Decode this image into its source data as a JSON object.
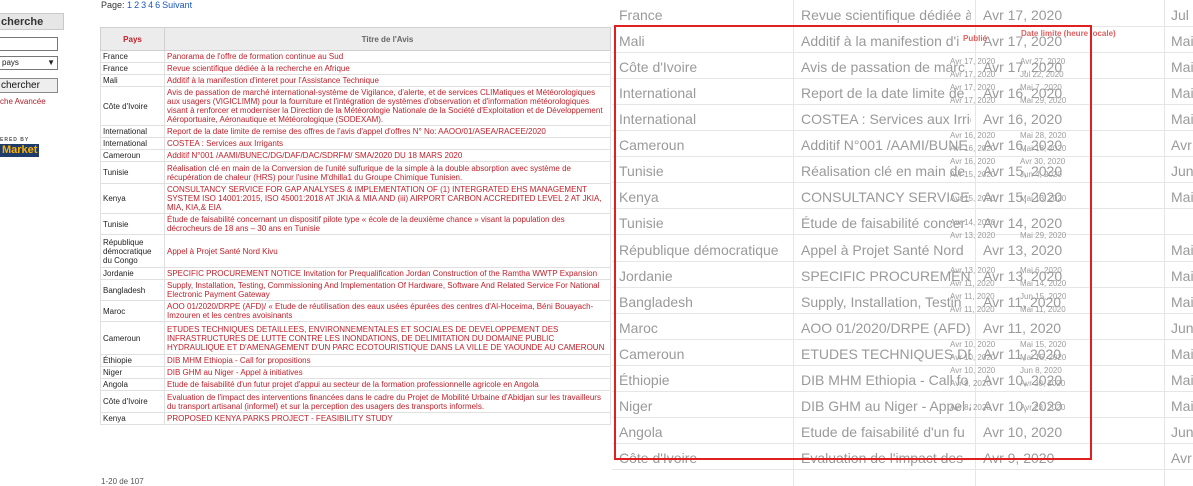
{
  "sidebar": {
    "title": "cherche",
    "select_value": "pays",
    "button_label": "chercher",
    "advanced_link": "che Avancée",
    "powered_by": "ERED BY",
    "logo_text": "Market"
  },
  "pager": {
    "prefix": "Page:",
    "pages": [
      "1",
      "2",
      "3",
      "4",
      "6"
    ],
    "next": "Suivant"
  },
  "results_count": "1-20 de 107",
  "table": {
    "headers": {
      "country": "Pays",
      "title": "Titre de l'Avis",
      "published": "Publié",
      "deadline": "Date limite (heure locale)"
    },
    "rows": [
      {
        "country": "France",
        "title": "Panorama de l'offre de formation continue au Sud",
        "published": "Avr 17, 2020",
        "deadline": "Avr 27, 2020"
      },
      {
        "country": "France",
        "title": "Revue scientifique dédiée à la recherche en Afrique",
        "published": "Avr 17, 2020",
        "deadline": "Jul 22, 2020"
      },
      {
        "country": "Mali",
        "title": "Additif à la manifestion d'interet pour l'Assistance Technique",
        "published": "Avr 17, 2020",
        "deadline": "Mai 7, 2020"
      },
      {
        "country": "Côte d'Ivoire",
        "title": "Avis de passation de marché international-système de Vigilance, d'alerte, et de services CLIMatiques et Météorologiques aux usagers (VIGICLIMM) pour la fourniture et l'intégration de systèmes d'observation et d'information météorologiques visant à renforcer et moderniser la Direction de la Météorologie Nationale de la Société d'Exploitation et de Développement Aéroportuaire, Aéronautique et Météorologique (SODEXAM).",
        "published": "Avr 17, 2020",
        "deadline": "Mai 29, 2020"
      },
      {
        "country": "International",
        "title": "Report de la date limite de remise des offres de l'avis d'appel d'offres N° No: AAOO/01/ASEA/RACEE/2020",
        "published": "Avr 16, 2020",
        "deadline": "Mai 28, 2020"
      },
      {
        "country": "International",
        "title": "COSTEA : Services aux Irrigants",
        "published": "Avr 16, 2020",
        "deadline": "Mai 18, 2020"
      },
      {
        "country": "Cameroun",
        "title": "Additif N°001 /AAMI/BUNEC/DG/DAF/DAC/SDRFM/ SMA/2020 DU 18 MARS 2020",
        "published": "Avr 16, 2020",
        "deadline": "Avr 30, 2020"
      },
      {
        "country": "Tunisie",
        "title": "Réalisation clé en main de la Conversion de l'unité sulfurique de la simple à la double absorption avec système de récupération de chaleur (HRS) pour l'usine M'dhilla1 du Groupe Chimique Tunisien.",
        "published": "Avr 15, 2020",
        "deadline": "Jun 4, 2020"
      },
      {
        "country": "Kenya",
        "title": "CONSULTANCY SERVICE FOR GAP ANALYSES & IMPLEMENTATION OF (1) INTERGRATED EHS MANAGEMENT SYSTEM ISO 14001:2015, ISO 45001:2018 AT JKIA & MIA AND (iii) AIRPORT CARBON ACCREDITED LEVEL 2 AT JKIA, MIA, KIA,& EIA",
        "published": "Avr 15, 2020",
        "deadline": "Mai 13, 2020"
      },
      {
        "country": "Tunisie",
        "title": "Étude de faisabilité concernant un dispositif pilote type « école de la deuxième chance » visant la population des décrocheurs de 18 ans – 30 ans en Tunisie",
        "published": "Avr 14, 2020",
        "deadline": ""
      },
      {
        "country": "République démocratique du Congo",
        "title": "Appel à Projet Santé Nord Kivu",
        "published": "Avr 13, 2020",
        "deadline": "Mai 29, 2020"
      },
      {
        "country": "Jordanie",
        "title": "SPECIFIC PROCUREMENT NOTICE Invitation for Prequalification Jordan Construction of the Ramtha WWTP Expansion",
        "published": "Avr 13, 2020",
        "deadline": "Mai 6, 2020"
      },
      {
        "country": "Bangladesh",
        "title": "Supply, Installation, Testing, Commissioning And Implementation Of Hardware, Software And Related Service For National Electronic Payment Gateway",
        "published": "Avr 11, 2020",
        "deadline": "Mai 14, 2020"
      },
      {
        "country": "Maroc",
        "title": "AOO 01/2020/DRPE (AFD)/ « Etude de réutilisation des eaux usées épurées des centres d'Al-Hoceima, Béni Bouayach-Imzouren et les centres avoisinants",
        "published": "Avr 11, 2020",
        "deadline": "Jun 15, 2020"
      },
      {
        "country": "Cameroun",
        "title": "ETUDES TECHNIQUES DETAILLEES, ENVIRONNEMENTALES ET SOCIALES DE DEVELOPPEMENT DES INFRASTRUCTURES DE LUTTE CONTRE LES INONDATIONS, DE DELIMITATION DU DOMAINE PUBLIC HYDRAULIQUE ET D'AMENAGEMENT D'UN PARC ECOTOURISTIQUE DANS LA VILLE DE YAOUNDE AU CAMEROUN",
        "published": "Avr 11, 2020",
        "deadline": "Mai 11, 2020"
      },
      {
        "country": "Éthiopie",
        "title": "DIB MHM Ethiopia - Call for propositions",
        "published": "Avr 10, 2020",
        "deadline": "Mai 15, 2020"
      },
      {
        "country": "Niger",
        "title": "DIB GHM au Niger - Appel à initiatives",
        "published": "Avr 10, 2020",
        "deadline": "Mai 15, 2020"
      },
      {
        "country": "Angola",
        "title": "Etude de faisabilité d'un futur projet d'appui au secteur de la formation professionnelle agricole en Angola",
        "published": "Avr 10, 2020",
        "deadline": "Jun 8, 2020"
      },
      {
        "country": "Côte d'Ivoire",
        "title": "Evaluation de l'impact des interventions financées dans le cadre du Projet de Mobilité Urbaine d'Abidjan sur les travailleurs du transport artisanal (informel) et sur la perception des usagers des transports informels.",
        "published": "Avr 9, 2020",
        "deadline": "Avr 30, 2020"
      },
      {
        "country": "Kenya",
        "title": "PROPOSED KENYA PARKS PROJECT - FEASIBILITY STUDY",
        "published": "Avr 8, 2020",
        "deadline": "Avr 23, 2020"
      }
    ]
  },
  "overlay_rows": [
    {
      "country": "France",
      "title": "Revue scientifique dédiée à",
      "date": "Avr 17, 2020",
      "deadline": "Jul 2"
    },
    {
      "country": "Mali",
      "title": "Additif à la manifestion d'i",
      "date": "Avr 17, 2020",
      "deadline": "Mai"
    },
    {
      "country": "Côte d'Ivoire",
      "title": "Avis de passation de marc",
      "date": "Avr 17, 2020",
      "deadline": "Mai"
    },
    {
      "country": "International",
      "title": "Report de la date limite de",
      "date": "Avr 16, 2020",
      "deadline": "Mai"
    },
    {
      "country": "International",
      "title": "COSTEA : Services aux Irrig",
      "date": "Avr 16, 2020",
      "deadline": "Mai"
    },
    {
      "country": "Cameroun",
      "title": "Additif N°001 /AAMI/BUNE",
      "date": "Avr 16, 2020",
      "deadline": "Avr 2"
    },
    {
      "country": "Tunisie",
      "title": "Réalisation clé en main de",
      "date": "Avr 15, 2020",
      "deadline": "Jun 4"
    },
    {
      "country": "Kenya",
      "title": "CONSULTANCY SERVICE FO",
      "date": "Avr 15, 2020",
      "deadline": "Mai"
    },
    {
      "country": "Tunisie",
      "title": "Étude de faisabilité concer",
      "date": "Avr 14, 2020",
      "deadline": ""
    },
    {
      "country": "République démocratique",
      "title": "Appel à Projet Santé Nord",
      "date": "Avr 13, 2020",
      "deadline": "Mai"
    },
    {
      "country": "Jordanie",
      "title": "SPECIFIC PROCUREMENT N",
      "date": "Avr 13, 2020",
      "deadline": "Mai"
    },
    {
      "country": "Bangladesh",
      "title": "Supply, Installation, Testin",
      "date": "Avr 11, 2020",
      "deadline": "Mai"
    },
    {
      "country": "Maroc",
      "title": "AOO 01/2020/DRPE (AFD)/",
      "date": "Avr 11, 2020",
      "deadline": "Jun 1"
    },
    {
      "country": "Cameroun",
      "title": "ETUDES TECHNIQUES DET/",
      "date": "Avr 11, 2020",
      "deadline": "Mai"
    },
    {
      "country": "Éthiopie",
      "title": "DIB MHM Ethiopia - Call fo",
      "date": "Avr 10, 2020",
      "deadline": "Mai"
    },
    {
      "country": "Niger",
      "title": "DIB GHM au Niger - Appel à",
      "date": "Avr 10, 2020",
      "deadline": "Mai"
    },
    {
      "country": "Angola",
      "title": "Etude de faisabilité d'un fu",
      "date": "Avr 10, 2020",
      "deadline": "Jun 8"
    },
    {
      "country": "Côte d'Ivoire",
      "title": "Evaluation de l'impact des",
      "date": "Avr 9, 2020",
      "deadline": "Avr 3"
    }
  ]
}
